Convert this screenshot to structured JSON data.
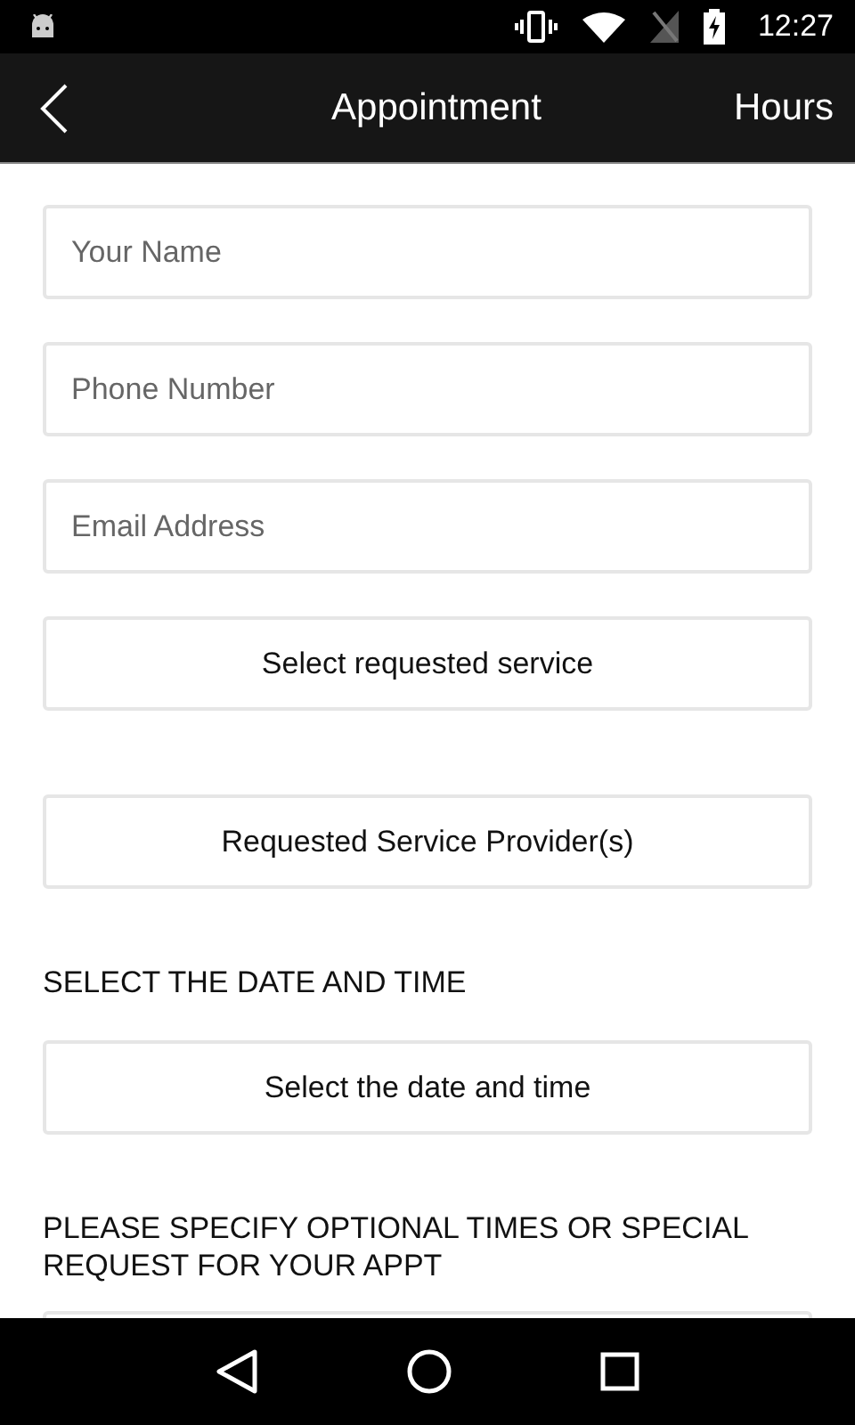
{
  "status_bar": {
    "time": "12:27"
  },
  "header": {
    "title": "Appointment",
    "action": "Hours"
  },
  "form": [
    {
      "kind": "input",
      "placeholder": "Your Name"
    },
    {
      "kind": "input",
      "placeholder": "Phone Number"
    },
    {
      "kind": "input",
      "placeholder": "Email Address"
    },
    {
      "kind": "select",
      "label": "Select requested service"
    },
    {
      "kind": "select",
      "label": "Requested Service Provider(s)"
    },
    {
      "kind": "heading",
      "label": "SELECT THE DATE AND TIME"
    },
    {
      "kind": "select",
      "label": "Select the date and time"
    },
    {
      "kind": "heading",
      "label": "PLEASE SPECIFY OPTIONAL TIMES OR SPECIAL REQUEST FOR YOUR APPT"
    },
    {
      "kind": "textarea"
    }
  ]
}
